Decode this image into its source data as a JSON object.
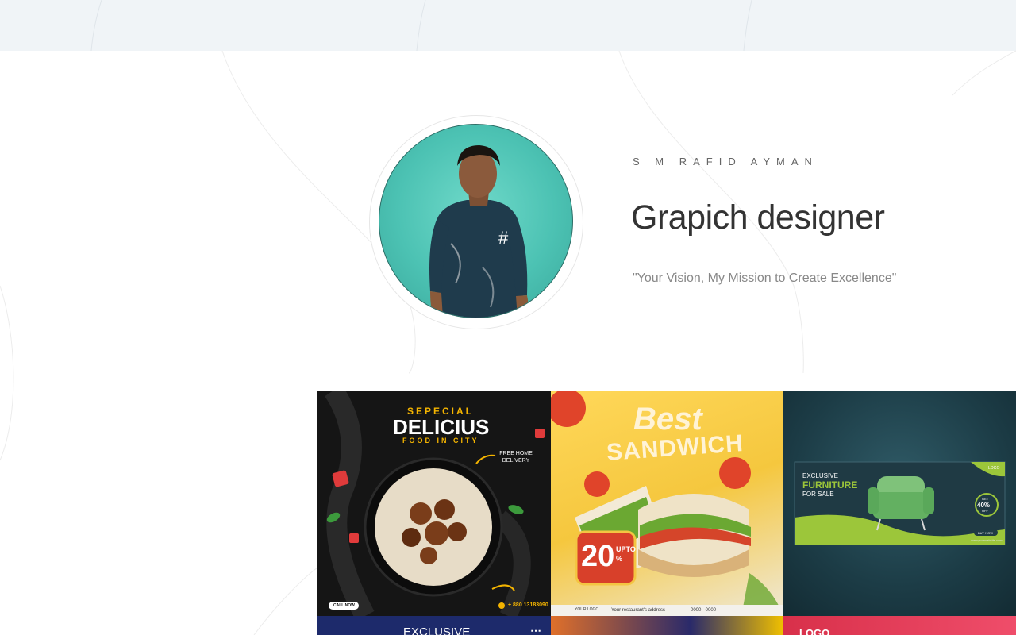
{
  "profile": {
    "name": "S M RAFID AYMAN",
    "role": "Grapich designer",
    "tagline": "\"Your Vision, My Mission to Create Excellence\""
  },
  "gallery": {
    "items": [
      {
        "kicker": "SEPECIAL",
        "headline": "DELICIUS",
        "subline": "FOOD IN CITY",
        "badge": "FREE HOME DELIVERY",
        "button": "CALL NOW",
        "phone": "+ 880 13183090"
      },
      {
        "headline_1": "Best",
        "headline_2": "SANDWICH",
        "discount": "20",
        "discount_suffix": "UPTO %",
        "address": "Your restaurant's address",
        "phone": "0000 - 0000",
        "logo": "YOUR LOGO"
      },
      {
        "kicker": "EXCLUSIVE",
        "headline": "FURNITURE",
        "subline": "FOR SALE",
        "badge_top": "GET",
        "badge_value": "40%",
        "badge_bottom": "OFF",
        "logo": "LOGO",
        "button": "BUY NOW",
        "url": "www.yourwebsite.com"
      },
      {
        "headline": "EXCLUSIVE"
      },
      {
        "headline": ""
      },
      {
        "headline": "LOGO"
      }
    ]
  },
  "colors": {
    "topbar": "#f0f4f7",
    "accent_teal": "#4cc2b3",
    "furniture_green": "#9cc63a"
  }
}
